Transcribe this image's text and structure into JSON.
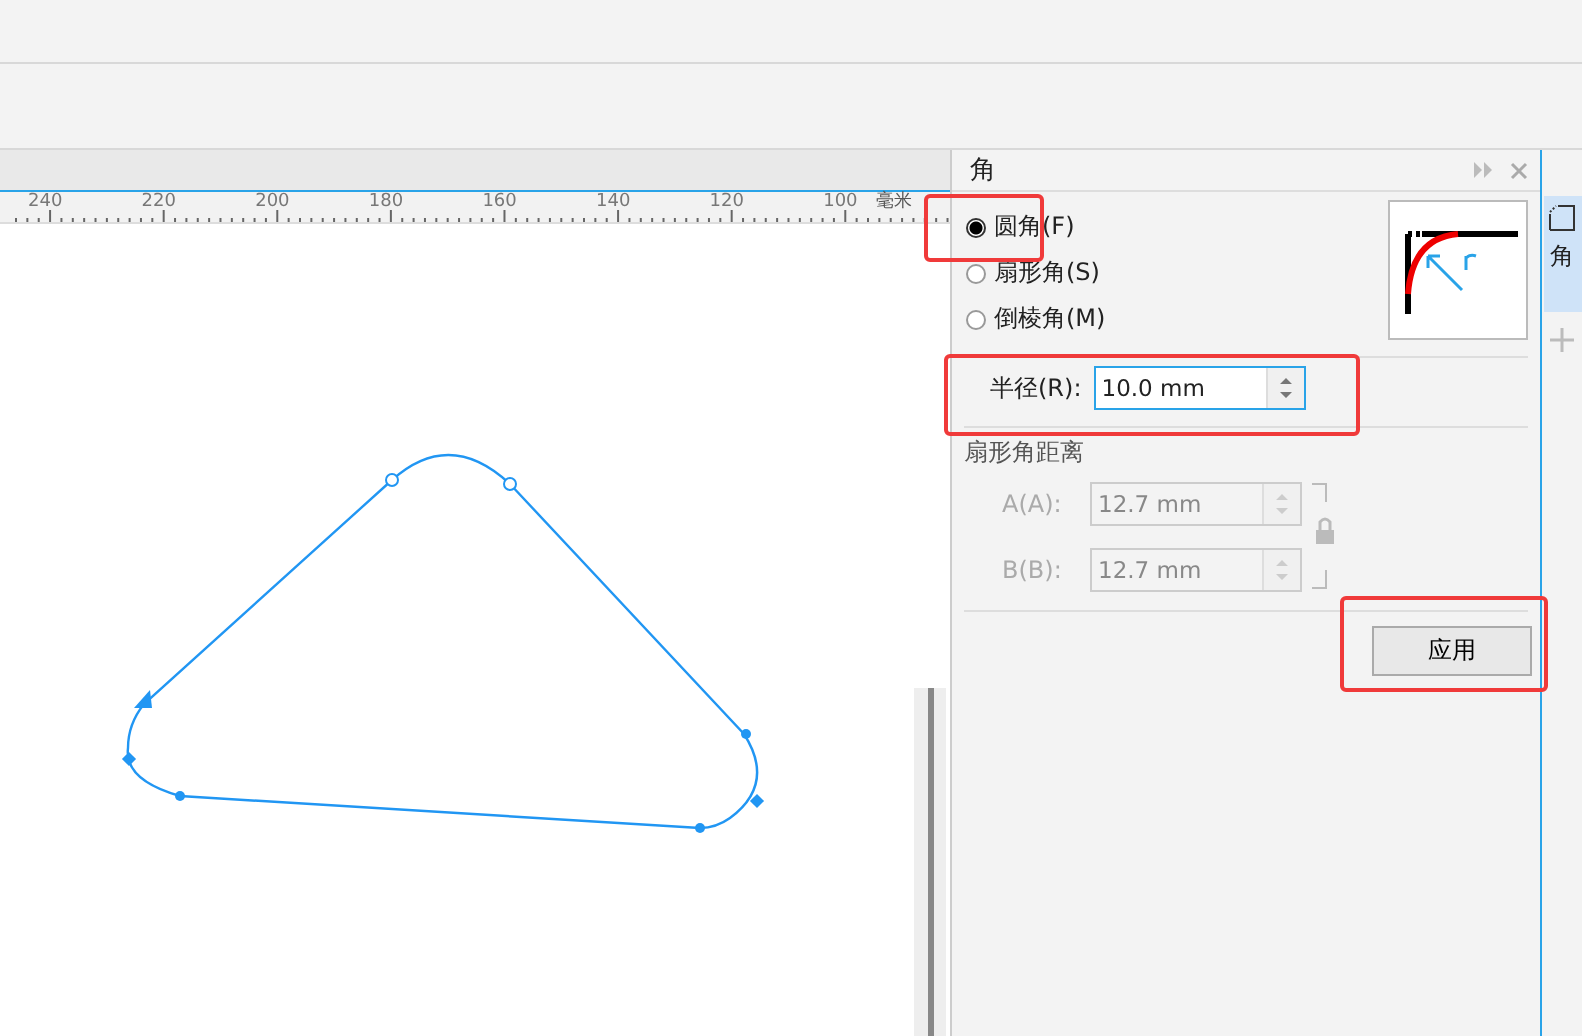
{
  "ruler": {
    "labels": [
      "240",
      "220",
      "200",
      "180",
      "160",
      "140",
      "120",
      "100"
    ],
    "unit": "毫米"
  },
  "panel": {
    "title": "角",
    "corner_types": [
      {
        "label": "圆角(F)",
        "selected": true
      },
      {
        "label": "扇形角(S)",
        "selected": false
      },
      {
        "label": "倒棱角(M)",
        "selected": false
      }
    ],
    "radius": {
      "label": "半径(R):",
      "value": "10.0 mm"
    },
    "distance_section": {
      "title": "扇形角距离",
      "fields": [
        {
          "label": "A(A):",
          "value": "12.7 mm",
          "disabled": true
        },
        {
          "label": "B(B):",
          "value": "12.7 mm",
          "disabled": true
        }
      ]
    },
    "apply_button": "应用"
  },
  "side_tabs": [
    {
      "label": "角",
      "selected": true
    }
  ]
}
